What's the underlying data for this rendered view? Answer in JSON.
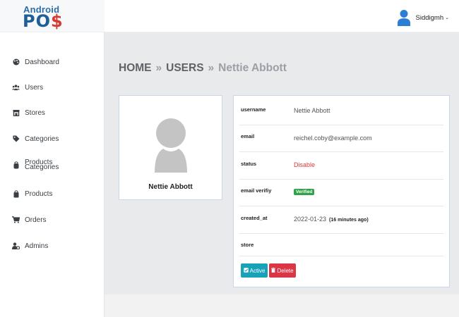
{
  "logo": {
    "top": "Android",
    "bottom_main": "PO",
    "bottom_dollar": "$"
  },
  "header": {
    "user_name": "Siddigmh",
    "caret": "⌄"
  },
  "sidebar": {
    "items": [
      {
        "label": "Dashboard",
        "icon": "palette-icon"
      },
      {
        "label": "Users",
        "icon": "users-icon"
      },
      {
        "label": "Stores",
        "icon": "store-icon"
      },
      {
        "label": "Categories",
        "icon": "tag-icon"
      },
      {
        "label": "Categories",
        "overlap_label": "Products",
        "icon": "shopping-bag-icon"
      },
      {
        "label": "Products",
        "icon": "shopping-bag-icon"
      },
      {
        "label": "Orders",
        "icon": "cart-icon"
      },
      {
        "label": "Admins",
        "icon": "user-cog-icon"
      }
    ]
  },
  "breadcrumb": {
    "home": "HOME",
    "sep": "»",
    "users": "USERS",
    "current": "Nettie Abbott"
  },
  "profile": {
    "name": "Nettie Abbott"
  },
  "details": {
    "username_label": "username",
    "username_value": "Nettie Abbott",
    "email_label": "email",
    "email_value": "reichel.coby@example.com",
    "status_label": "status",
    "status_value": "Disable",
    "email_verify_label": "email verifiy",
    "email_verify_badge": "Verified",
    "created_label": "created_at",
    "created_value": "2022-01-23",
    "created_note": "(16 minutes ago)",
    "store_label": "store"
  },
  "actions": {
    "active_label": "Active",
    "delete_label": "Delete"
  },
  "colors": {
    "active": "#17a2b8",
    "delete": "#dc3545",
    "verified": "#2fa24a",
    "disable": "#d9383a"
  }
}
